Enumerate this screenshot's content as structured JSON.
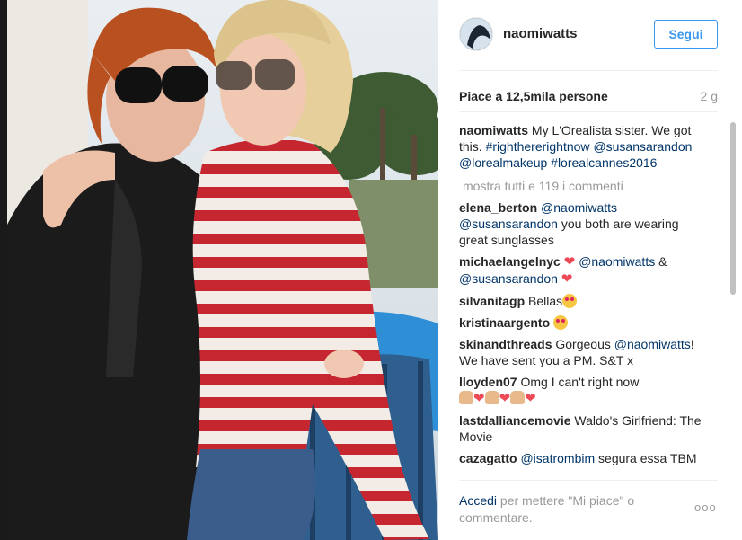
{
  "post": {
    "username": "naomiwatts",
    "follow_label": "Segui",
    "likes": "Piace a 12,5mila persone",
    "time": "2 g"
  },
  "caption": {
    "username": "naomiwatts",
    "text": "My L'Orealista sister. We got this.",
    "tags": [
      "#righthererightnow",
      "@susansarandon",
      "@lorealmakeup",
      "#lorealcannes2016"
    ]
  },
  "view_all": "mostra tutti e 119 i commenti",
  "comments": [
    {
      "user": "elena_berton",
      "mention": "@naomiwatts",
      "mention2": "@susansarandon",
      "text": "you both are wearing great sunglasses"
    },
    {
      "user": "michaelangelnyc",
      "mention": "@naomiwatts",
      "connector": "&",
      "mention2": "@susansarandon"
    },
    {
      "user": "silvanitagp",
      "text": "Bellas"
    },
    {
      "user": "kristinaargento"
    },
    {
      "user": "skinandthreads",
      "text": "Gorgeous",
      "mention": "@naomiwatts",
      "text2": "! We have sent you a PM. S&T x"
    },
    {
      "user": "lloyden07",
      "text": "Omg I can't right now"
    },
    {
      "user": "lastdalliancemovie",
      "text": "Waldo's Girlfriend: The Movie"
    },
    {
      "user": "cazagatto",
      "mention": "@isatrombim",
      "text": "segura essa TBM"
    }
  ],
  "footer": {
    "login": "Accedi",
    "rest": "per mettere \"Mi piace\" o commentare.",
    "more": "ooo"
  },
  "icons": {
    "heart": "heart-icon",
    "more": "more-options-icon"
  },
  "colors": {
    "link": "#003569",
    "accent": "#3897f0",
    "heart": "#ed4956"
  }
}
